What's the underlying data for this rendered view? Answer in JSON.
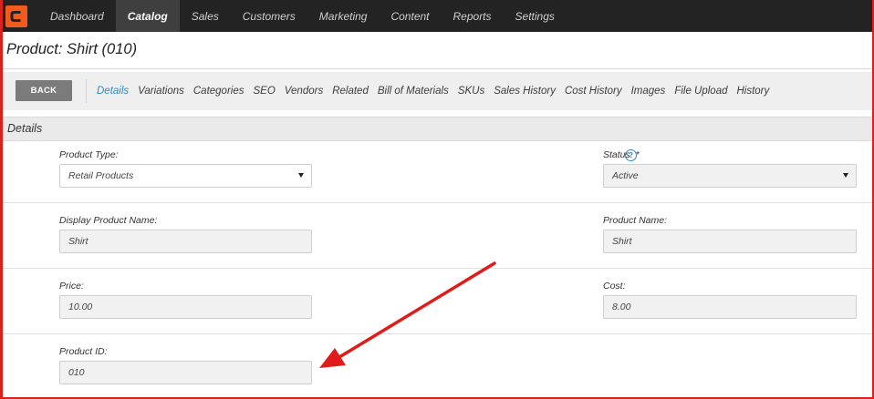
{
  "nav": {
    "items": [
      {
        "label": "Dashboard",
        "active": false
      },
      {
        "label": "Catalog",
        "active": true
      },
      {
        "label": "Sales",
        "active": false
      },
      {
        "label": "Customers",
        "active": false
      },
      {
        "label": "Marketing",
        "active": false
      },
      {
        "label": "Content",
        "active": false
      },
      {
        "label": "Reports",
        "active": false
      },
      {
        "label": "Settings",
        "active": false
      }
    ]
  },
  "page": {
    "title": "Product: Shirt (010)"
  },
  "toolbar": {
    "back_label": "BACK",
    "tabs": [
      {
        "label": "Details",
        "active": true
      },
      {
        "label": "Variations"
      },
      {
        "label": "Categories"
      },
      {
        "label": "SEO"
      },
      {
        "label": "Vendors"
      },
      {
        "label": "Related"
      },
      {
        "label": "Bill of Materials"
      },
      {
        "label": "SKUs"
      },
      {
        "label": "Sales History"
      },
      {
        "label": "Cost History"
      },
      {
        "label": "Images"
      },
      {
        "label": "File Upload"
      },
      {
        "label": "History"
      }
    ]
  },
  "section": {
    "title": "Details"
  },
  "form": {
    "product_type": {
      "label": "Product Type:",
      "value": "Retail Products"
    },
    "status": {
      "label": "Status: *",
      "value": "Active",
      "help": "?"
    },
    "display_name": {
      "label": "Display Product Name:",
      "value": "Shirt"
    },
    "product_name": {
      "label": "Product Name:",
      "value": "Shirt"
    },
    "price": {
      "label": "Price:",
      "value": "10.00"
    },
    "cost": {
      "label": "Cost:",
      "value": "8.00"
    },
    "product_id": {
      "label": "Product ID:",
      "value": "010"
    }
  },
  "annotation": {
    "arrow_color": "#e01b1b"
  },
  "colors": {
    "accent": "#2a8ccc",
    "brand": "#f25a1e",
    "nav_bg": "#232323"
  }
}
